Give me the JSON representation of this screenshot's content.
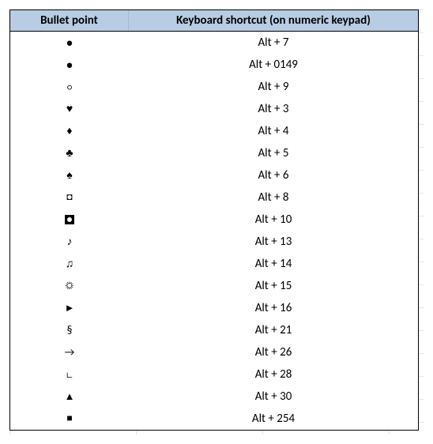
{
  "headers": {
    "col1": "Bullet point",
    "col2": "Keyboard shortcut (on numeric keypad)"
  },
  "rows": [
    {
      "bullet": "•",
      "bullet_name": "filled-dot",
      "shortcut": "Alt + 7"
    },
    {
      "bullet": "•",
      "bullet_name": "filled-dot",
      "shortcut": "Alt + 0149"
    },
    {
      "bullet": "○",
      "bullet_name": "hollow-circle",
      "shortcut": "Alt + 9"
    },
    {
      "bullet": "♥",
      "bullet_name": "heart",
      "shortcut": "Alt + 3"
    },
    {
      "bullet": "♦",
      "bullet_name": "diamond",
      "shortcut": "Alt + 4"
    },
    {
      "bullet": "♣",
      "bullet_name": "club",
      "shortcut": "Alt + 5"
    },
    {
      "bullet": "♠",
      "bullet_name": "spade",
      "shortcut": "Alt + 6"
    },
    {
      "bullet": "◘",
      "bullet_name": "inverse-bullet",
      "shortcut": "Alt + 8"
    },
    {
      "bullet": "svg:inverse-circle",
      "bullet_name": "inverse-circle",
      "shortcut": "Alt + 10"
    },
    {
      "bullet": "♪",
      "bullet_name": "eighth-note",
      "shortcut": "Alt + 13"
    },
    {
      "bullet": "♫",
      "bullet_name": "beamed-notes",
      "shortcut": "Alt + 14"
    },
    {
      "bullet": "☼",
      "bullet_name": "sun",
      "shortcut": "Alt + 15"
    },
    {
      "bullet": "►",
      "bullet_name": "right-pointer",
      "shortcut": "Alt + 16"
    },
    {
      "bullet": "§",
      "bullet_name": "section-sign",
      "shortcut": "Alt + 21"
    },
    {
      "bullet": "→",
      "bullet_name": "right-arrow",
      "shortcut": "Alt + 26"
    },
    {
      "bullet": "∟",
      "bullet_name": "right-angle",
      "shortcut": "Alt + 28"
    },
    {
      "bullet": "▲",
      "bullet_name": "up-triangle",
      "shortcut": "Alt + 30"
    },
    {
      "bullet": "■",
      "bullet_name": "filled-square",
      "shortcut": "Alt + 254"
    }
  ]
}
